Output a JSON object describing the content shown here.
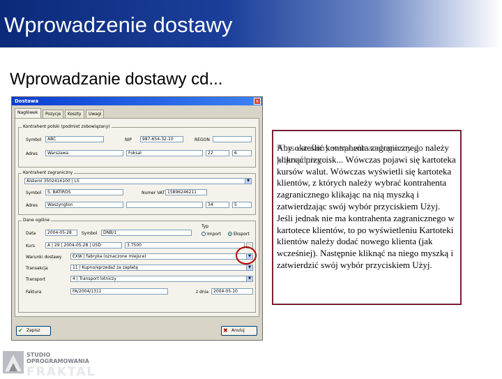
{
  "slide": {
    "title": "Wprowadzenie dostawy",
    "subtitle": "Wprowadzanie dostawy cd..."
  },
  "dialog": {
    "title": "Dostawa",
    "close": "x",
    "tabs": [
      "Nagłówek",
      "Pozycje",
      "Koszty",
      "Uwagi"
    ],
    "group_pl": {
      "title": "Kontrahent polski (podmiot zobowiązany)",
      "symbol_label": "Symbol",
      "symbol": "ABC",
      "nip_label": "NIP",
      "nip": "987-654-32-10",
      "regon_label": "REGON",
      "address_label": "Adres",
      "city": "Warszawa",
      "street": "Foksal",
      "num1": "22",
      "num2": "6"
    },
    "group_foreign": {
      "title": "Kontrahent zagraniczny",
      "selected": "Alsterol 3502416100 | LS",
      "symbol_label": "Symbol",
      "symbol": "S. BATIROS",
      "vat_label": "Numer VAT",
      "vat": "15896246211",
      "address_label": "Adres",
      "city": "Waszyngton",
      "num1": "34",
      "num2": "5"
    },
    "group_general": {
      "title": "Dane ogólne",
      "date_label": "Data",
      "date": "2004-05-28",
      "symbol_label": "Symbol",
      "symbol": "DNB/1",
      "type_label": "Typ",
      "import_label": "Import",
      "export_label": "Eksport",
      "rate_label": "Kurs",
      "rate": "A | 29 | 2004-05-28 | USD",
      "rate_value": "3.7500",
      "delivery_label": "Warunki dostawy",
      "delivery": "EXW | fabryka (oznaczone miejsce)",
      "transaction_label": "Transakcja",
      "transaction": "11 | Kupno/sprzedaż za zapłatą",
      "transport_label": "Transport",
      "transport": "4 | Transport lotniczy",
      "invoice_label": "Faktura",
      "invoice": "FA/2004/1311",
      "date2_label": "z dnia",
      "date2": "2004-05-10"
    },
    "buttons": {
      "save": "Zapisz",
      "cancel": "Anuluj"
    }
  },
  "note": {
    "overlay": "Kurs ustalamy w sposób analogiczny do poprzedniego",
    "text": "Aby określić kontrahenta zagranicznego należy kliknąć przycisk... Wówczas pojawi się kartoteka kursów walut. Wówczas wyświetli się kartoteka klientów, z których należy wybrać kontrahenta zagranicznego klikając na nią myszką i zatwierdzając swój wybór przyciskiem Użyj. Jeśli jednak nie ma kontrahenta zagranicznego w kartotece klientów, to po wyświetleniu Kartoteki klientów należy dodać nowego klienta (jak wcześniej). Następnie kliknąć na niego myszką i zatwierdzić swój wybór przyciskiem Użyj."
  },
  "logo": {
    "line1": "STUDIO",
    "line2": "OPROGRAMOWANIA",
    "line3": "FRAKTAL"
  }
}
